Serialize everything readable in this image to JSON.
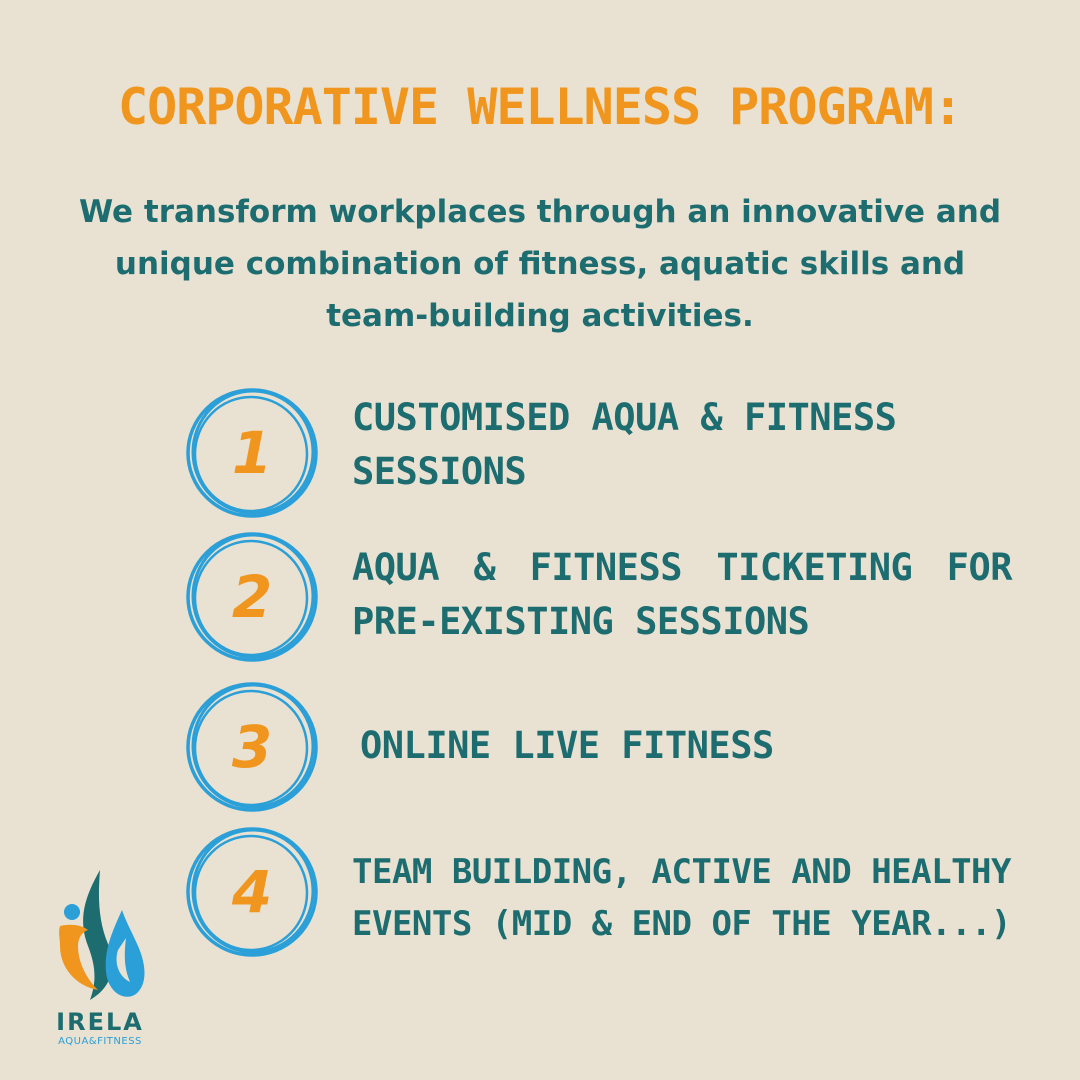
{
  "title": "Corporative Wellness Program:",
  "subtitle": "We transform workplaces through an innovative and unique combination of fitness, aquatic skills and team-building activities.",
  "items": [
    {
      "number": "1",
      "text": "Customised Aqua  & Fitness Sessions"
    },
    {
      "number": "2",
      "text": "Aqua & Fitness Ticketing for pre-existing sessions"
    },
    {
      "number": "3",
      "text": "Online Live Fitness"
    },
    {
      "number": "4",
      "text": "Team building, active and healthy events (mid & end of the year...)"
    }
  ],
  "logo": {
    "name": "IRELA",
    "tagline": "AQUA&FITNESS"
  },
  "colors": {
    "background": "#e9e2d2",
    "orange": "#f0961e",
    "teal": "#1c6c70",
    "blue": "#2a9fd8"
  }
}
